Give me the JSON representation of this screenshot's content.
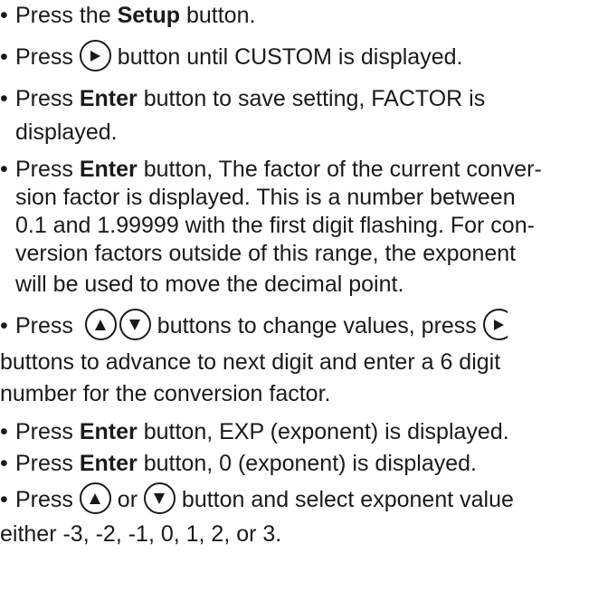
{
  "steps": [
    {
      "pre": "Press the ",
      "bold": "Setup",
      "post": " button."
    },
    {
      "pre": "Press ",
      "post": " button until CUSTOM is  displayed."
    },
    {
      "pre": "Press ",
      "bold": "Enter",
      "post": " button to save setting, FACTOR is",
      "cont": [
        "displayed."
      ]
    },
    {
      "pre": "Press ",
      "bold": "Enter",
      "post": " button, The factor of the current conver-",
      "cont": [
        "sion factor is  displayed. This is a number between",
        "0.1 and 1.99999 with the first digit flashing.  For  con-",
        "version  factors outside of this range, the exponent",
        "will be used to move the decimal point."
      ]
    },
    {
      "pre": "Press ",
      "mid": " buttons to change values, press ",
      "cont": [
        "buttons to advance to next digit and enter a 6 digit",
        "number for the  conversion factor."
      ]
    },
    {
      "pre": "Press ",
      "bold": "Enter",
      "post": " button, EXP (exponent) is displayed."
    },
    {
      "pre": "Press ",
      "bold": "Enter",
      "post": " button, 0 (exponent) is displayed."
    },
    {
      "pre": "Press ",
      "mid": " or ",
      "post": " button and select exponent value",
      "cont": [
        "either -3, -2, -1, 0, 1, 2, or 3."
      ]
    }
  ],
  "bullet": "•",
  "icons": {
    "right": "right-arrow-button",
    "up": "up-arrow-button",
    "down": "down-arrow-button"
  }
}
